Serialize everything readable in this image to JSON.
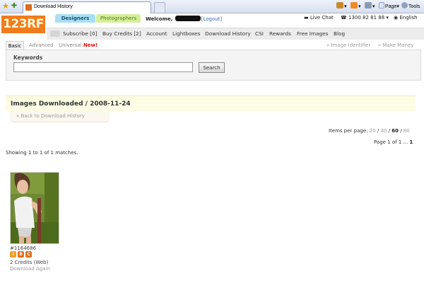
{
  "browser": {
    "tab_title": "Download History",
    "commands": {
      "page": "Page",
      "tools": "Tools"
    }
  },
  "header": {
    "logo": {
      "main": "123",
      "accent": "RF"
    },
    "designers_tab": "Designers",
    "photographers_tab": "Photographers",
    "welcome_label": "Welcome,",
    "logout_label": "[Logout]",
    "live_chat": "Live Chat",
    "phone": "1300 82 81 88",
    "language": "English"
  },
  "nav": {
    "items": [
      "Subscribe [0]",
      "Buy Credits [2]",
      "Account",
      "Lightboxes",
      "Download History",
      "CSI",
      "Rewards",
      "Free Images",
      "Blog"
    ]
  },
  "search": {
    "tabs": {
      "basic": "Basic",
      "advanced": "Advanced",
      "universal": "Universal",
      "new_badge": "New!"
    },
    "links": {
      "image_identifier": "Image Identifier",
      "make_money": "Make Money"
    },
    "keywords_label": "Keywords",
    "keywords_value": "",
    "search_button": "Search"
  },
  "content": {
    "title": "Images Downloaded / 2008-11-24",
    "back_link": "Back to Download History",
    "per_page_label": "Items per page:",
    "per_page_options": [
      "20",
      "40",
      "60",
      "80"
    ],
    "per_page_selected": "60",
    "pagination_label": "Page 1 of 1 ...",
    "pagination_current": "1",
    "showing": "Showing 1 to 1 of 1 matches."
  },
  "result": {
    "image_id": "#1164686",
    "credits": "2 Credits (Web)",
    "download_again": "Download Again",
    "license_icons": [
      "i",
      "B",
      "C"
    ]
  },
  "colors": {
    "brand_orange": "#f07c1e",
    "designers_blue": "#a8dff2",
    "photographers_green": "#d5ef9b",
    "title_band": "#fdfce4"
  }
}
